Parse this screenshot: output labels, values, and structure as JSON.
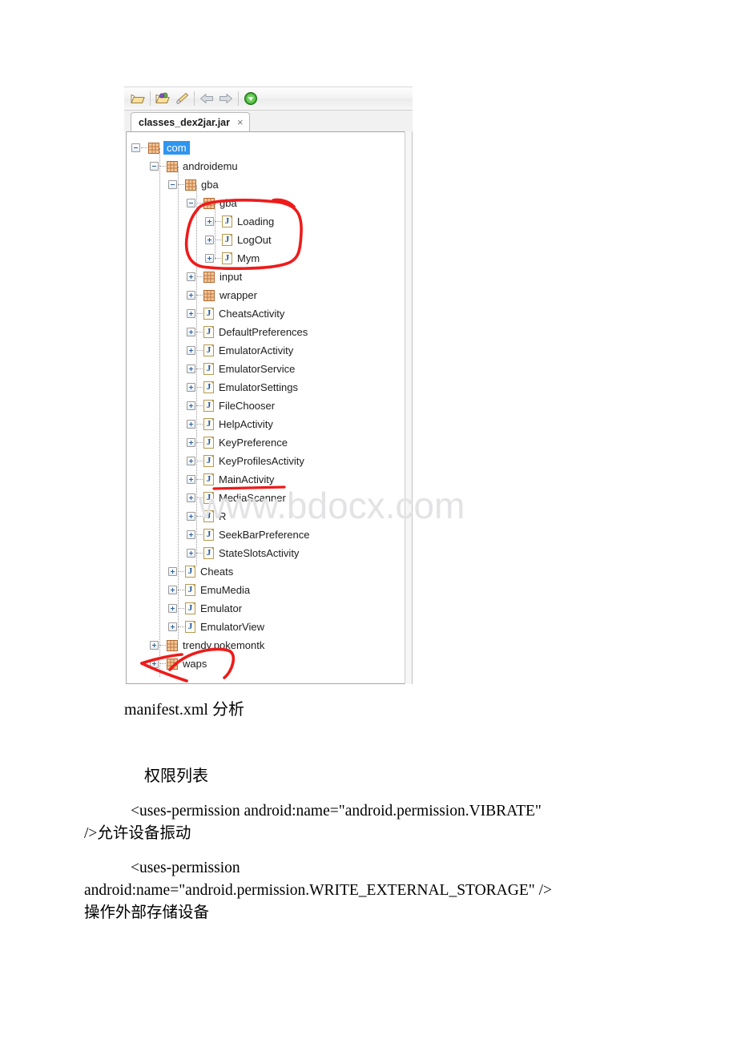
{
  "figure": {
    "toolbar": {
      "buttons": [
        {
          "name": "open-folder-icon",
          "label": "Open"
        },
        {
          "name": "open-recent-icon",
          "label": "Open Recent"
        },
        {
          "name": "clean-icon",
          "label": "Clean"
        },
        {
          "name": "back-arrow-icon",
          "label": "Back"
        },
        {
          "name": "forward-arrow-icon",
          "label": "Forward"
        },
        {
          "name": "run-icon",
          "label": "Run"
        }
      ]
    },
    "tab": {
      "title": "classes_dex2jar.jar",
      "close_label": "×"
    },
    "tree": [
      {
        "label": "com",
        "depth": 0,
        "icon": "package",
        "toggle": "minus",
        "selected": true
      },
      {
        "label": "androidemu",
        "depth": 1,
        "icon": "package",
        "toggle": "minus",
        "selected": false
      },
      {
        "label": "gba",
        "depth": 2,
        "icon": "package",
        "toggle": "minus",
        "selected": false
      },
      {
        "label": "gba",
        "depth": 3,
        "icon": "package",
        "toggle": "minus",
        "selected": false
      },
      {
        "label": "Loading",
        "depth": 4,
        "icon": "java",
        "toggle": "plus",
        "selected": false
      },
      {
        "label": "LogOut",
        "depth": 4,
        "icon": "java",
        "toggle": "plus",
        "selected": false
      },
      {
        "label": "Mym",
        "depth": 4,
        "icon": "java",
        "toggle": "plus",
        "selected": false
      },
      {
        "label": "input",
        "depth": 3,
        "icon": "package",
        "toggle": "plus",
        "selected": false
      },
      {
        "label": "wrapper",
        "depth": 3,
        "icon": "package",
        "toggle": "plus",
        "selected": false
      },
      {
        "label": "CheatsActivity",
        "depth": 3,
        "icon": "java",
        "toggle": "plus",
        "selected": false
      },
      {
        "label": "DefaultPreferences",
        "depth": 3,
        "icon": "java",
        "toggle": "plus",
        "selected": false
      },
      {
        "label": "EmulatorActivity",
        "depth": 3,
        "icon": "java",
        "toggle": "plus",
        "selected": false
      },
      {
        "label": "EmulatorService",
        "depth": 3,
        "icon": "java",
        "toggle": "plus",
        "selected": false
      },
      {
        "label": "EmulatorSettings",
        "depth": 3,
        "icon": "java",
        "toggle": "plus",
        "selected": false
      },
      {
        "label": "FileChooser",
        "depth": 3,
        "icon": "java",
        "toggle": "plus",
        "selected": false
      },
      {
        "label": "HelpActivity",
        "depth": 3,
        "icon": "java",
        "toggle": "plus",
        "selected": false
      },
      {
        "label": "KeyPreference",
        "depth": 3,
        "icon": "java",
        "toggle": "plus",
        "selected": false
      },
      {
        "label": "KeyProfilesActivity",
        "depth": 3,
        "icon": "java",
        "toggle": "plus",
        "selected": false
      },
      {
        "label": "MainActivity",
        "depth": 3,
        "icon": "java",
        "toggle": "plus",
        "selected": false
      },
      {
        "label": "MediaScanner",
        "depth": 3,
        "icon": "java",
        "toggle": "plus",
        "selected": false
      },
      {
        "label": "R",
        "depth": 3,
        "icon": "java",
        "toggle": "plus",
        "selected": false
      },
      {
        "label": "SeekBarPreference",
        "depth": 3,
        "icon": "java",
        "toggle": "plus",
        "selected": false
      },
      {
        "label": "StateSlotsActivity",
        "depth": 3,
        "icon": "java",
        "toggle": "plus",
        "selected": false
      },
      {
        "label": "Cheats",
        "depth": 2,
        "icon": "java",
        "toggle": "plus",
        "selected": false
      },
      {
        "label": "EmuMedia",
        "depth": 2,
        "icon": "java",
        "toggle": "plus",
        "selected": false
      },
      {
        "label": "Emulator",
        "depth": 2,
        "icon": "java",
        "toggle": "plus",
        "selected": false
      },
      {
        "label": "EmulatorView",
        "depth": 2,
        "icon": "java",
        "toggle": "plus",
        "selected": false
      },
      {
        "label": "trendy.pokemontk",
        "depth": 1,
        "icon": "package",
        "toggle": "plus",
        "selected": false
      },
      {
        "label": "waps",
        "depth": 1,
        "icon": "package",
        "toggle": "plus",
        "selected": false
      }
    ],
    "annotations": {
      "color": "#ee1b1b",
      "items": [
        {
          "name": "red-circle-gba-subpackage",
          "target": "gba / Loading / LogOut / Mym"
        },
        {
          "name": "red-underline-mainactivity",
          "target": "MainActivity"
        },
        {
          "name": "red-arrow-waps",
          "target": "waps"
        }
      ]
    },
    "watermark": "www.bdocx.com"
  },
  "document": {
    "heading_manifest": "manifest.xml 分析",
    "heading_permissions": "权限列表",
    "permission1_line1": "<uses-permission android:name=\"android.permission.VIBRATE\"",
    "permission1_line2": "/>允许设备振动",
    "permission2_line1": "<uses-permission",
    "permission2_line2": "android:name=\"android.permission.WRITE_EXTERNAL_STORAGE\" />",
    "permission2_line3": "操作外部存储设备"
  }
}
